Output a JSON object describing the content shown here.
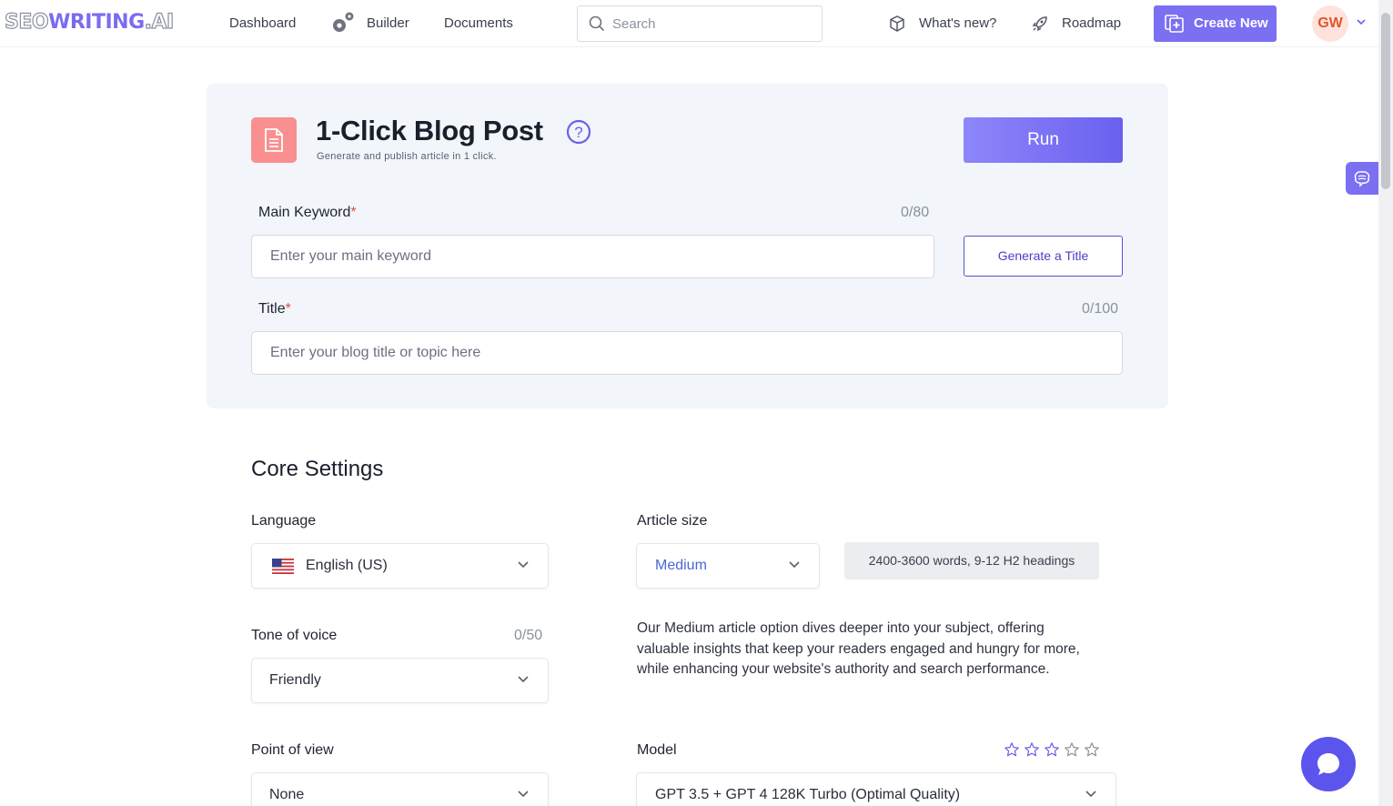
{
  "nav": {
    "logo": {
      "seo": "SEO",
      "writing": "WRITING",
      "ai": ".AI"
    },
    "links": {
      "dashboard": "Dashboard",
      "builder": "Builder",
      "documents": "Documents"
    },
    "search_placeholder": "Search",
    "whats_new": "What's new?",
    "roadmap": "Roadmap",
    "create_new": "Create New",
    "user_initials": "GW"
  },
  "header": {
    "title": "1-Click Blog Post",
    "subtitle": "Generate and publish article in 1 click.",
    "run_label": "Run"
  },
  "form": {
    "keyword": {
      "label": "Main Keyword",
      "required": "*",
      "counter": "0/80",
      "placeholder": "Enter your main keyword",
      "value": ""
    },
    "generate_title_label": "Generate a Title",
    "title": {
      "label": "Title",
      "required": "*",
      "counter": "0/100",
      "placeholder": "Enter your blog title or topic here",
      "value": ""
    }
  },
  "core_settings": {
    "heading": "Core Settings",
    "language": {
      "label": "Language",
      "value": "English (US)"
    },
    "article_size": {
      "label": "Article size",
      "value": "Medium",
      "info": "2400-3600 words, 9-12 H2 headings"
    },
    "tone": {
      "label": "Tone of voice",
      "counter": "0/50",
      "value": "Friendly"
    },
    "description": "Our Medium article option dives deeper into your subject, offering valuable insights that keep your readers engaged and hungry for more, while enhancing your website's authority and search performance.",
    "point_of_view": {
      "label": "Point of view",
      "value": "None"
    },
    "model": {
      "label": "Model",
      "value": "GPT 3.5 + GPT 4 128K Turbo (Optimal Quality)",
      "rating": 0,
      "rating_max": 5
    }
  },
  "colors": {
    "accent": "#7b6ff2",
    "required": "#e24b4b",
    "doc_icon": "#f98f8f",
    "avatar_text": "#e0562e"
  },
  "icons": [
    "gear-icon",
    "search-icon",
    "box-icon",
    "rocket-icon",
    "add-document-icon",
    "chevron-down-icon",
    "document-icon",
    "help-icon",
    "us-flag-icon",
    "star-icon",
    "chat-icon",
    "brain-icon"
  ]
}
